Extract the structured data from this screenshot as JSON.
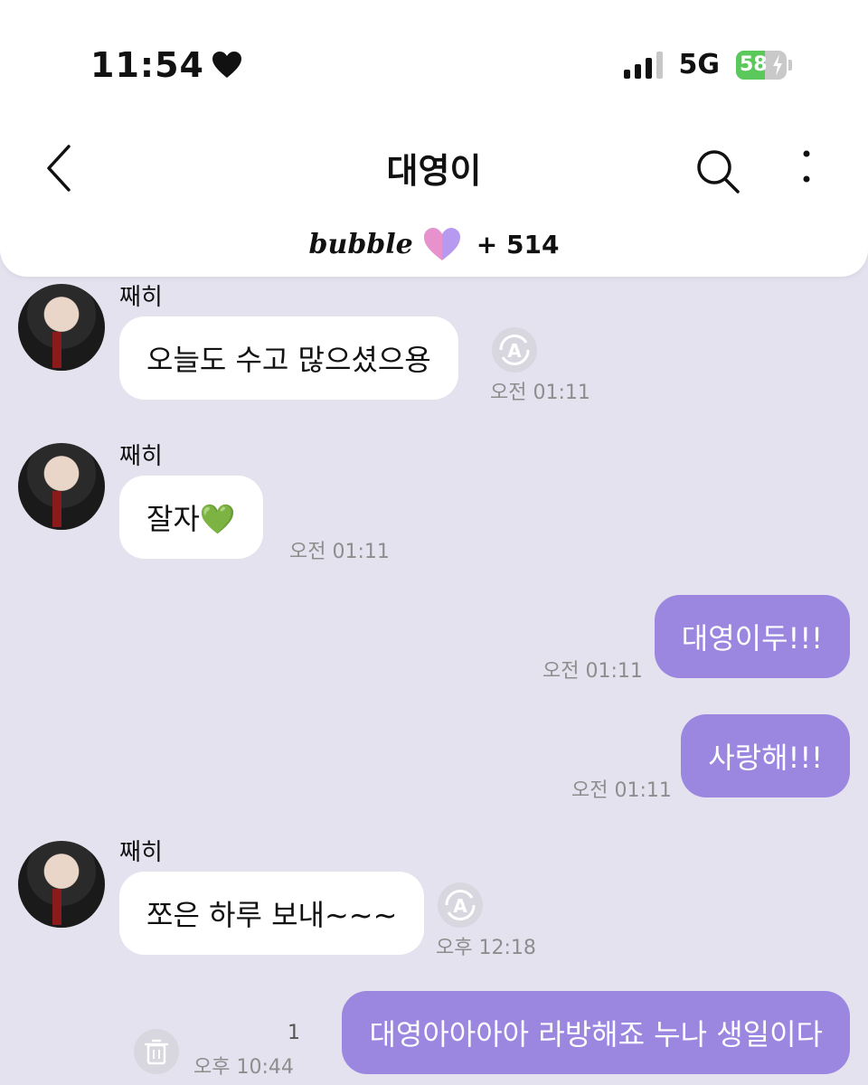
{
  "status_bar": {
    "time": "11:54",
    "network": "5G",
    "battery": "58"
  },
  "header": {
    "title": "대영이",
    "brand": "bubble",
    "plan_count": "+ 514"
  },
  "messages": [
    {
      "sender": "째히",
      "text": "오늘도 수고 많으셨으용",
      "time": "오전 01:11"
    },
    {
      "sender": "째히",
      "text": "잘자💚",
      "time": "오전 01:11"
    },
    {
      "text": "대영이두!!!",
      "time": "오전 01:11"
    },
    {
      "text": "사랑해!!!",
      "time": "오전 01:11"
    },
    {
      "sender": "째히",
      "text": "쪼은 하루 보내~~~",
      "time": "오후 12:18"
    },
    {
      "text": "대영아아아아 라방해죠 누나 생일이다",
      "time": "오후 10:44",
      "unread": "1"
    }
  ],
  "colors": {
    "background": "#e5e2ef",
    "outgoing_bubble": "#9b86e0",
    "battery_fill": "#5ac85a"
  },
  "icons": [
    "heart-icon",
    "back-chevron-icon",
    "search-icon",
    "more-vertical-icon",
    "bubble-heart-icon",
    "translate-icon",
    "trash-icon"
  ]
}
